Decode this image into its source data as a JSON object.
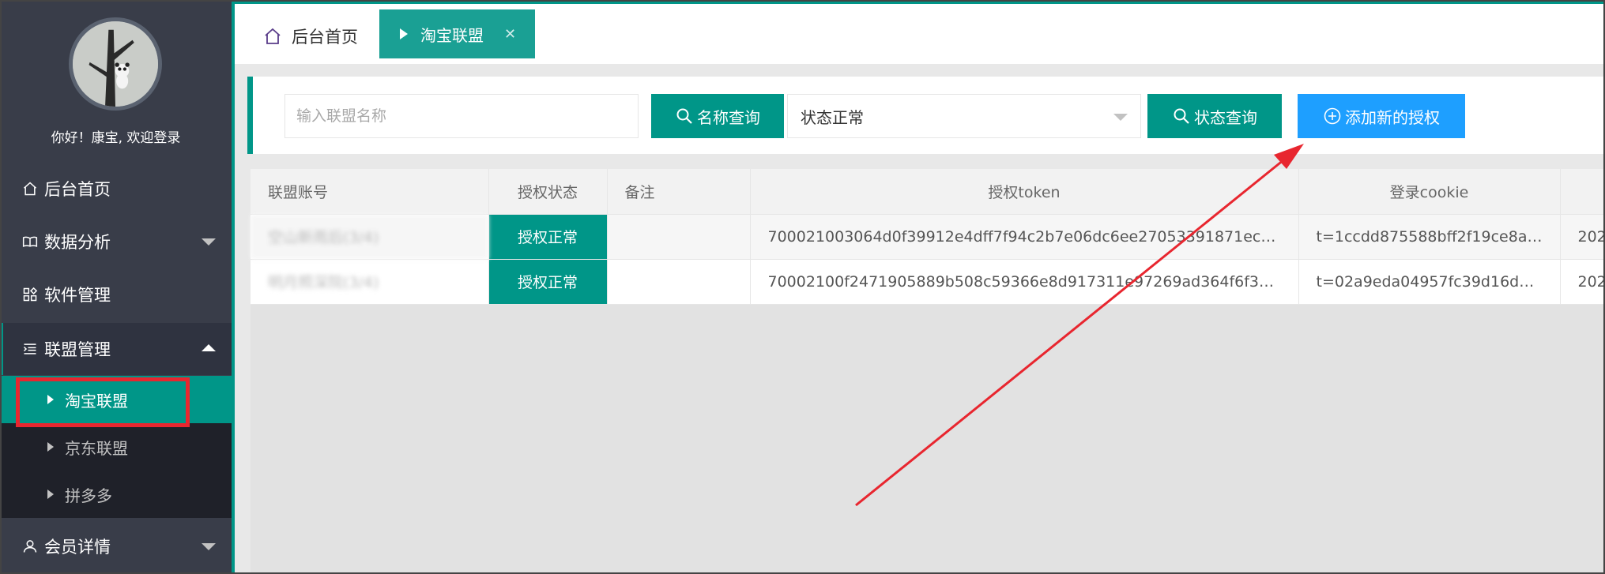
{
  "sidebar": {
    "welcome": "你好！康宝, 欢迎登录",
    "items": [
      {
        "label": "后台首页"
      },
      {
        "label": "数据分析"
      },
      {
        "label": "软件管理"
      },
      {
        "label": "联盟管理"
      },
      {
        "label": "会员详情"
      }
    ],
    "sub_items": [
      {
        "label": "淘宝联盟"
      },
      {
        "label": "京东联盟"
      },
      {
        "label": "拼多多"
      }
    ]
  },
  "tabs": {
    "home": "后台首页",
    "active": "淘宝联盟",
    "close": "✕"
  },
  "search": {
    "name_placeholder": "输入联盟名称",
    "name_button": "名称查询",
    "status_selected": "状态正常",
    "status_button": "状态查询",
    "add_button": "添加新的授权"
  },
  "table": {
    "headers": [
      "联盟账号",
      "授权状态",
      "备注",
      "授权token",
      "登录cookie",
      ""
    ],
    "rows": [
      {
        "account": "空山新雨后(3/4)",
        "status": "授权正常",
        "note": "",
        "token": "700021003064d0f39912e4dff7f94c2b7e06dc6ee27053391871ec1a…",
        "cookie": "t=1ccdd875588bff2f19ce8a…",
        "extra": "202"
      },
      {
        "account": "明月照深院(3/4)",
        "status": "授权正常",
        "note": "",
        "token": "70002100f2471905889b508c59366e8d917311e97269ad364f6f305…",
        "cookie": "t=02a9eda04957fc39d16de…",
        "extra": "202"
      }
    ]
  },
  "colors": {
    "accent": "#009688",
    "sidebar_bg": "#393d49",
    "primary_blue": "#1e9fff",
    "annotation_red": "#e8262f"
  }
}
